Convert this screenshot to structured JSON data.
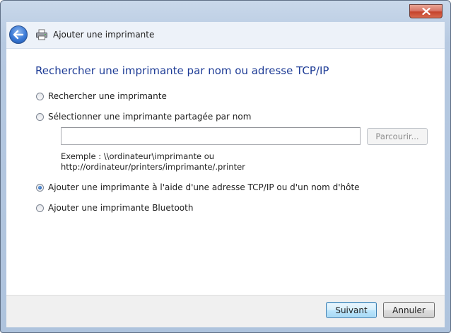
{
  "window": {
    "title": "Ajouter une imprimante",
    "close_icon": "close-icon",
    "back_icon": "back-arrow-icon",
    "app_icon": "printer-icon"
  },
  "main": {
    "heading": "Rechercher une imprimante par nom ou adresse TCP/IP",
    "options": [
      {
        "label": "Rechercher une imprimante",
        "selected": false
      },
      {
        "label": "Sélectionner une imprimante partagée par nom",
        "selected": false
      },
      {
        "label": "Ajouter une imprimante à l'aide d'une adresse TCP/IP ou d'un nom d'hôte",
        "selected": true
      },
      {
        "label": "Ajouter une imprimante Bluetooth",
        "selected": false
      }
    ],
    "shared_name_input": {
      "value": "",
      "placeholder": ""
    },
    "browse_label": "Parcourir...",
    "example_line1": "Exemple : \\\\ordinateur\\imprimante ou",
    "example_line2": "http://ordinateur/printers/imprimante/.printer"
  },
  "footer": {
    "next_label": "Suivant",
    "cancel_label": "Annuler"
  },
  "colors": {
    "heading": "#1e3c96",
    "frame": "#b6c9e1",
    "close": "#c5432c"
  }
}
